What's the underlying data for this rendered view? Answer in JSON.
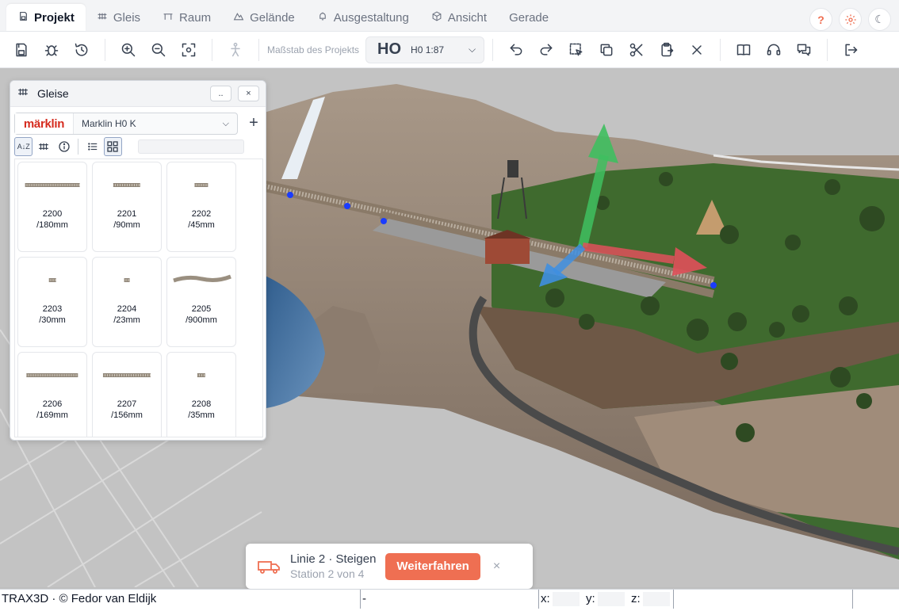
{
  "tabs": [
    {
      "label": "Projekt",
      "icon": "save-icon",
      "active": true
    },
    {
      "label": "Gleis",
      "icon": "track-icon",
      "active": false
    },
    {
      "label": "Raum",
      "icon": "table-icon",
      "active": false
    },
    {
      "label": "Gelände",
      "icon": "terrain-icon",
      "active": false
    },
    {
      "label": "Ausgestaltung",
      "icon": "tree-icon",
      "active": false
    },
    {
      "label": "Ansicht",
      "icon": "cube-icon",
      "active": false
    },
    {
      "label": "Gerade",
      "icon": "",
      "active": false
    }
  ],
  "header_right": {
    "help": "?",
    "theme": "☾"
  },
  "toolbar": {
    "scale_label": "Maßstab des Projekts",
    "scale_main": "HO",
    "scale_sub": "H0  1:87"
  },
  "panel": {
    "title": "Gleise",
    "more_label": "..",
    "close_label": "×",
    "brand_logo": "märklin",
    "brand_name": "Marklin H0 K",
    "add_label": "+",
    "sort_label": "A↓Z",
    "search_placeholder": ""
  },
  "tiles": [
    {
      "label": "2200\n/180mm",
      "track_width_pct": 80
    },
    {
      "label": "2201\n/90mm",
      "track_width_pct": 40
    },
    {
      "label": "2202\n/45mm",
      "track_width_pct": 20
    },
    {
      "label": "2203\n/30mm",
      "track_width_pct": 10
    },
    {
      "label": "2204\n/23mm",
      "track_width_pct": 8
    },
    {
      "label": "2205\n/900mm",
      "track_width_pct": 82,
      "curved": true
    },
    {
      "label": "2206\n/169mm",
      "track_width_pct": 76
    },
    {
      "label": "2207\n/156mm",
      "track_width_pct": 70
    },
    {
      "label": "2208\n/35mm",
      "track_width_pct": 12
    }
  ],
  "notification": {
    "title": "Linie 2 · Steigen",
    "subtitle": "Station 2 von 4",
    "button": "Weiterfahren",
    "close": "×"
  },
  "statusbar": {
    "copyright": "TRAX3D · © Fedor van Eldijk",
    "info": "-",
    "x_label": "x:",
    "y_label": "y:",
    "z_label": "z:",
    "x": "",
    "y": "",
    "z": ""
  },
  "colors": {
    "accent": "#ef6f52",
    "gizmo_y": "#3fbf5f",
    "gizmo_x": "#e0505a",
    "gizmo_z": "#3f8fe0",
    "brand": "#d52b1e"
  }
}
